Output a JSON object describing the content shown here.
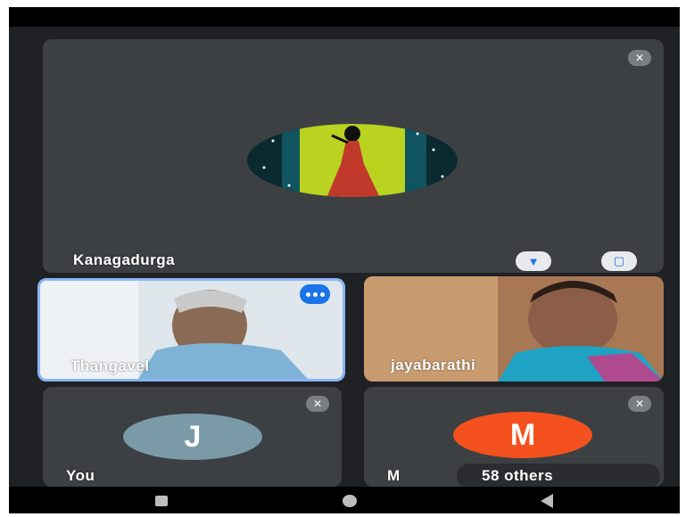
{
  "participants": {
    "main": {
      "name": "Kanagadurga"
    },
    "thangavel": {
      "name": "Thangavel"
    },
    "jaya": {
      "name": "jayabarathi"
    },
    "you": {
      "name": "You",
      "initial": "J",
      "color": "#7b9aa8"
    },
    "m": {
      "name": "M",
      "initial": "M",
      "color": "#f4511e",
      "others_label": "58 others"
    }
  },
  "icons": {
    "mute": "mic-off-icon",
    "pin": "pin-icon",
    "fullscreen": "fullscreen-icon",
    "speaking": "speaking-indicator-icon"
  },
  "colors": {
    "background": "#202124",
    "tile": "#3c4043",
    "highlight": "#8ab4f8",
    "accent": "#1a73e8"
  }
}
